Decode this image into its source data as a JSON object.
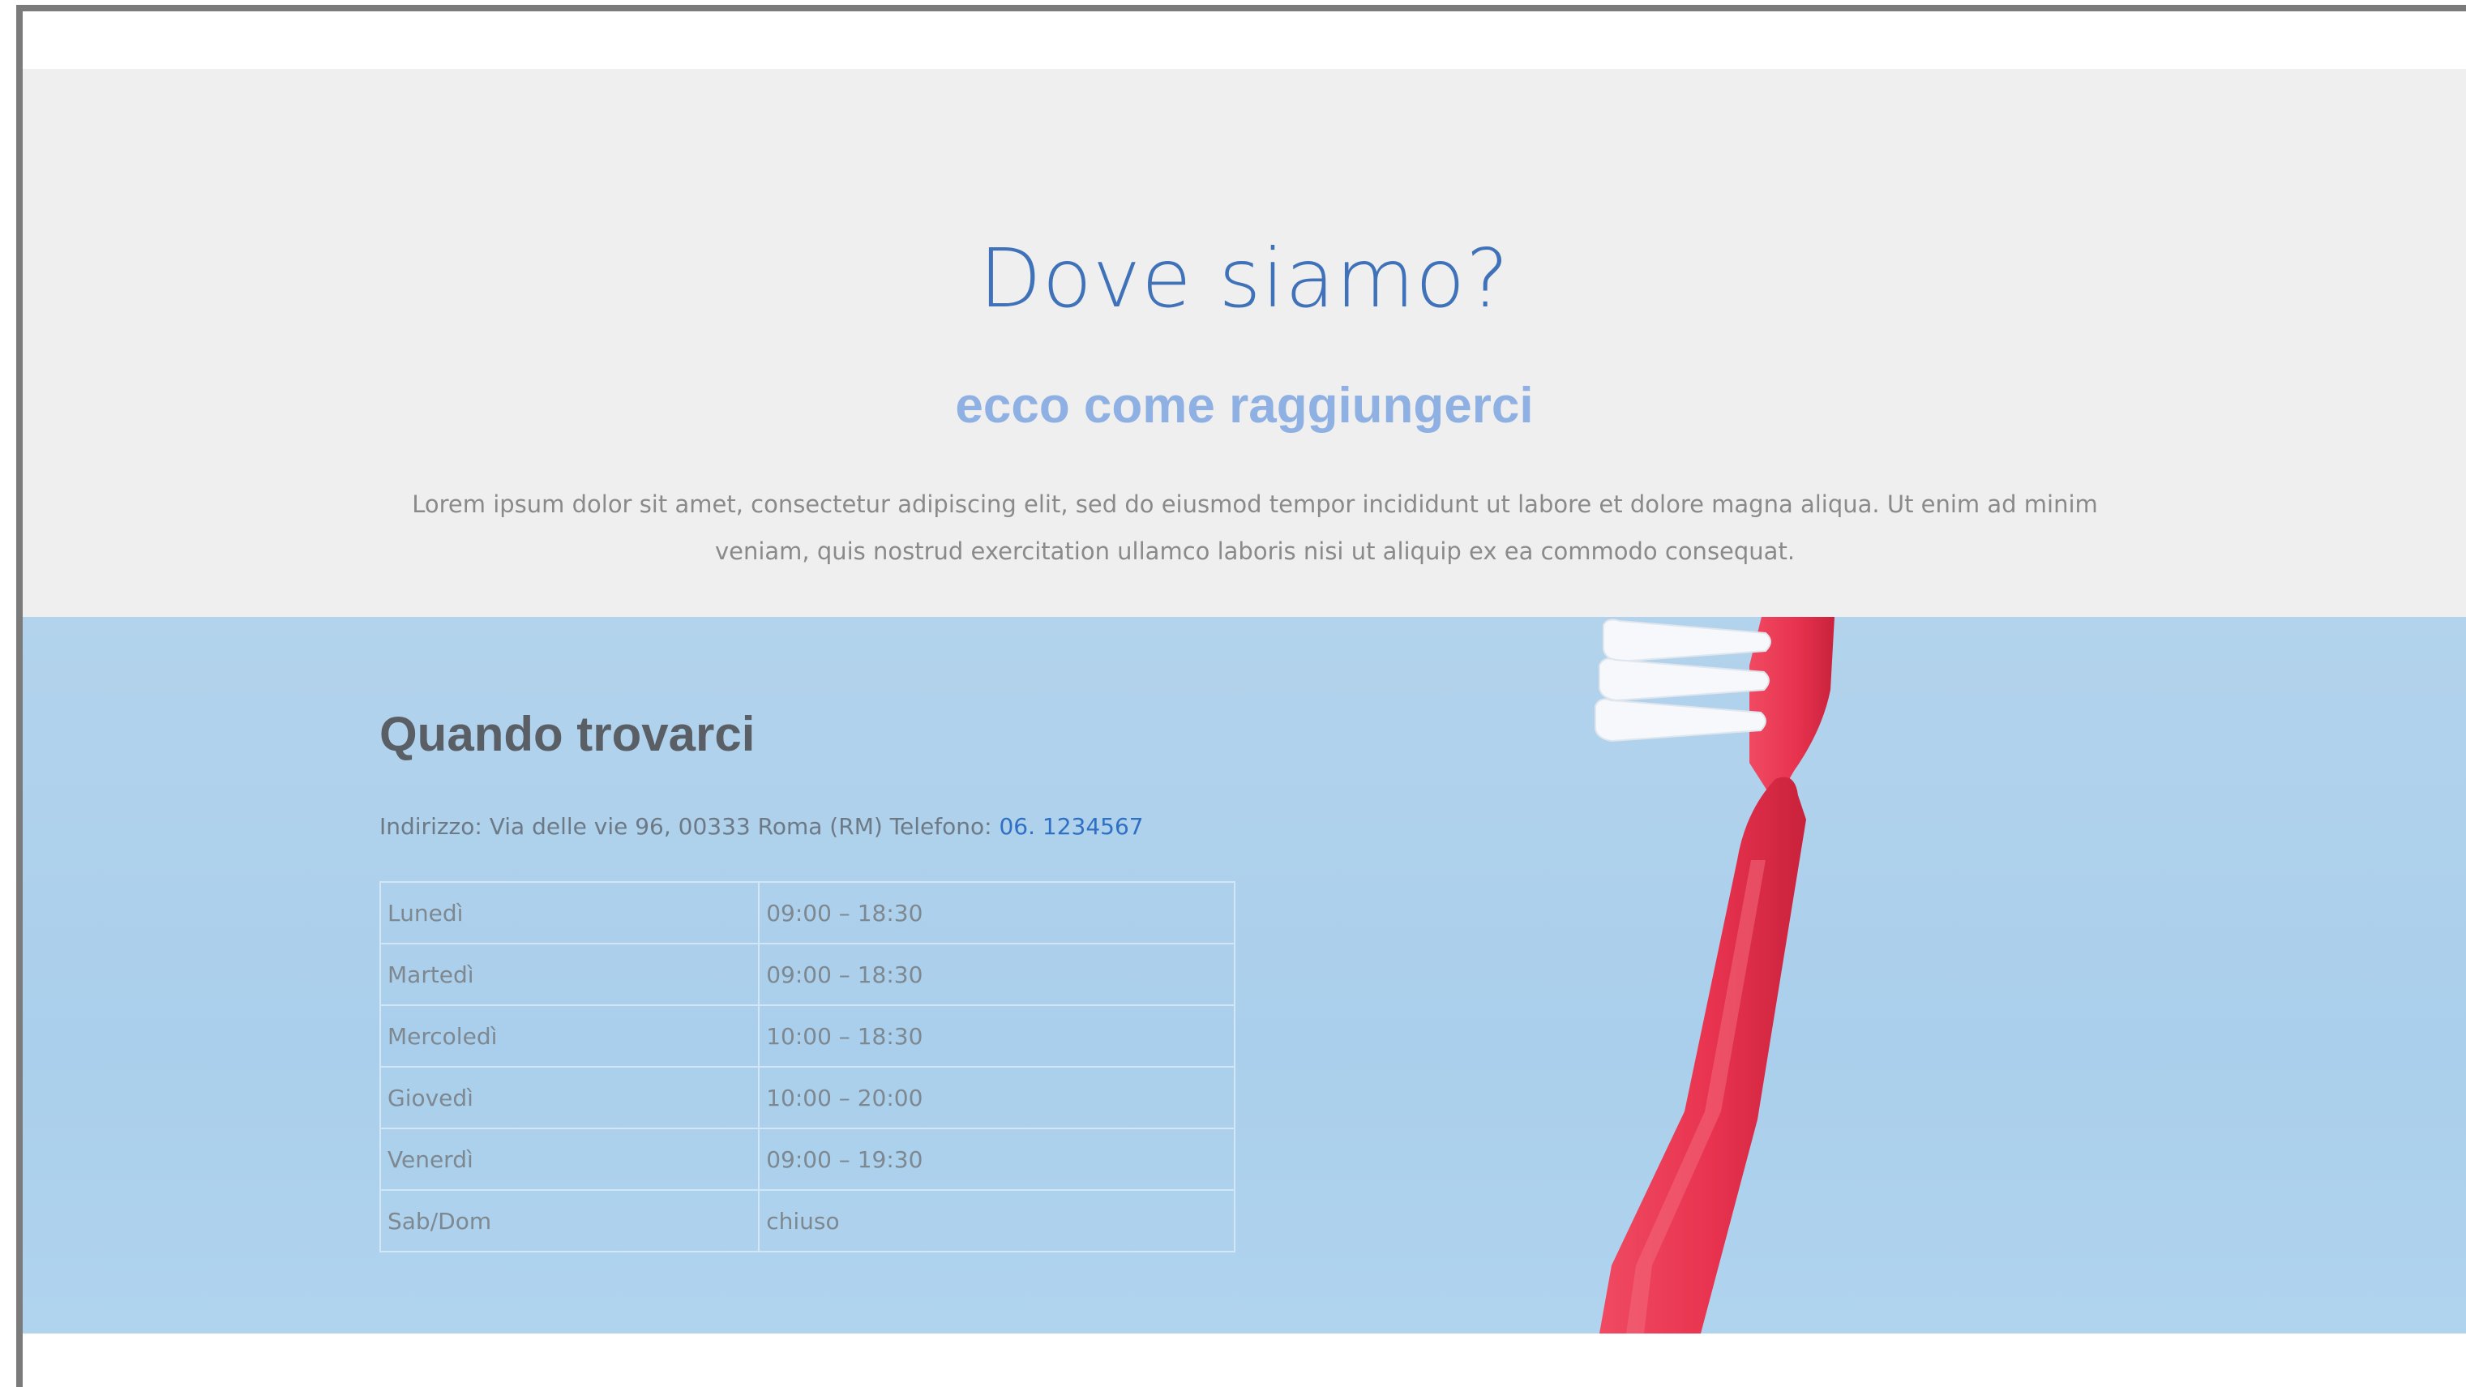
{
  "intro": {
    "title": "Dove siamo?",
    "subtitle": "ecco come raggiungerci",
    "text": "Lorem ipsum dolor sit amet, consectetur adipiscing elit, sed do eiusmod tempor incididunt ut labore et dolore magna aliqua. Ut enim ad minim veniam, quis nostrud exercitation ullamco laboris nisi ut aliquip ex ea commodo consequat."
  },
  "hours": {
    "title": "Quando trovarci",
    "address_label": "Indirizzo: Via delle vie 96, 00333 Roma (RM) Telefono: ",
    "phone": "06. 1234567",
    "rows": [
      {
        "day": "Lunedì",
        "time": "09:00 – 18:30"
      },
      {
        "day": "Martedì",
        "time": "09:00 – 18:30"
      },
      {
        "day": "Mercoledì",
        "time": "10:00 – 18:30"
      },
      {
        "day": "Giovedì",
        "time": "10:00 – 20:00"
      },
      {
        "day": "Venerdì",
        "time": "09:00 – 19:30"
      },
      {
        "day": "Sab/Dom",
        "time": "chiuso"
      }
    ]
  },
  "colors": {
    "title_blue": "#3f72b8",
    "subtitle_blue": "#8fb0e2",
    "section_blue": "#aacfec",
    "toothbrush_red": "#e8334f"
  }
}
